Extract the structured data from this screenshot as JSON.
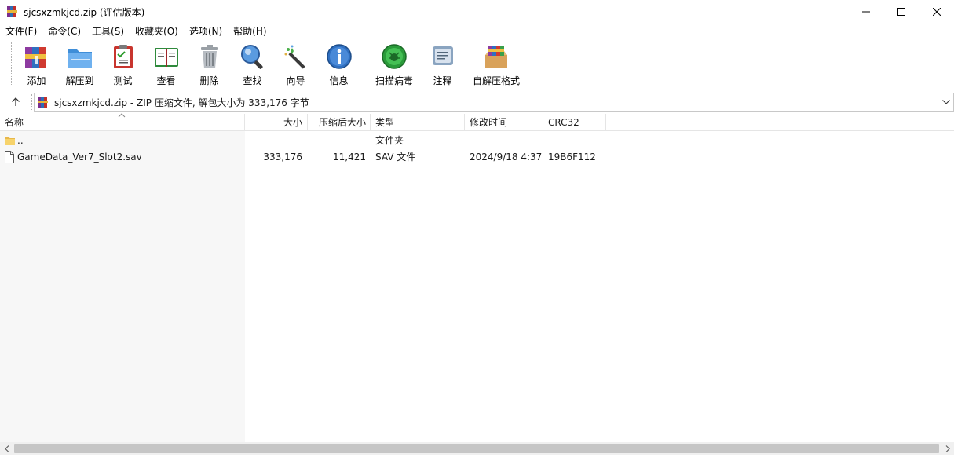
{
  "window": {
    "title": "sjcsxzmkjcd.zip (评估版本)",
    "minimize_icon": "minimize-icon",
    "maximize_icon": "maximize-icon",
    "close_icon": "close-icon"
  },
  "menu": [
    "文件(F)",
    "命令(C)",
    "工具(S)",
    "收藏夹(O)",
    "选项(N)",
    "帮助(H)"
  ],
  "toolbar": {
    "add": "添加",
    "extract_to": "解压到",
    "test": "测试",
    "view": "查看",
    "delete": "删除",
    "find": "查找",
    "wizard": "向导",
    "info": "信息",
    "virus_scan": "扫描病毒",
    "comment": "注释",
    "sfx": "自解压格式"
  },
  "address": {
    "text": "sjcsxzmkjcd.zip - ZIP 压缩文件, 解包大小为 333,176 字节"
  },
  "columns": {
    "name": "名称",
    "size": "大小",
    "packed": "压缩后大小",
    "type": "类型",
    "modified": "修改时间",
    "crc": "CRC32"
  },
  "files": [
    {
      "name": "..",
      "size": "",
      "packed": "",
      "type": "文件夹",
      "modified": "",
      "crc": "",
      "icon": "folder-icon"
    },
    {
      "name": "GameData_Ver7_Slot2.sav",
      "size": "333,176",
      "packed": "11,421",
      "type": "SAV 文件",
      "modified": "2024/9/18 4:37",
      "crc": "19B6F112",
      "icon": "file-icon"
    }
  ],
  "colors": {
    "accent": "#0078d7",
    "left_pane_shade": "#f7f7f7"
  }
}
